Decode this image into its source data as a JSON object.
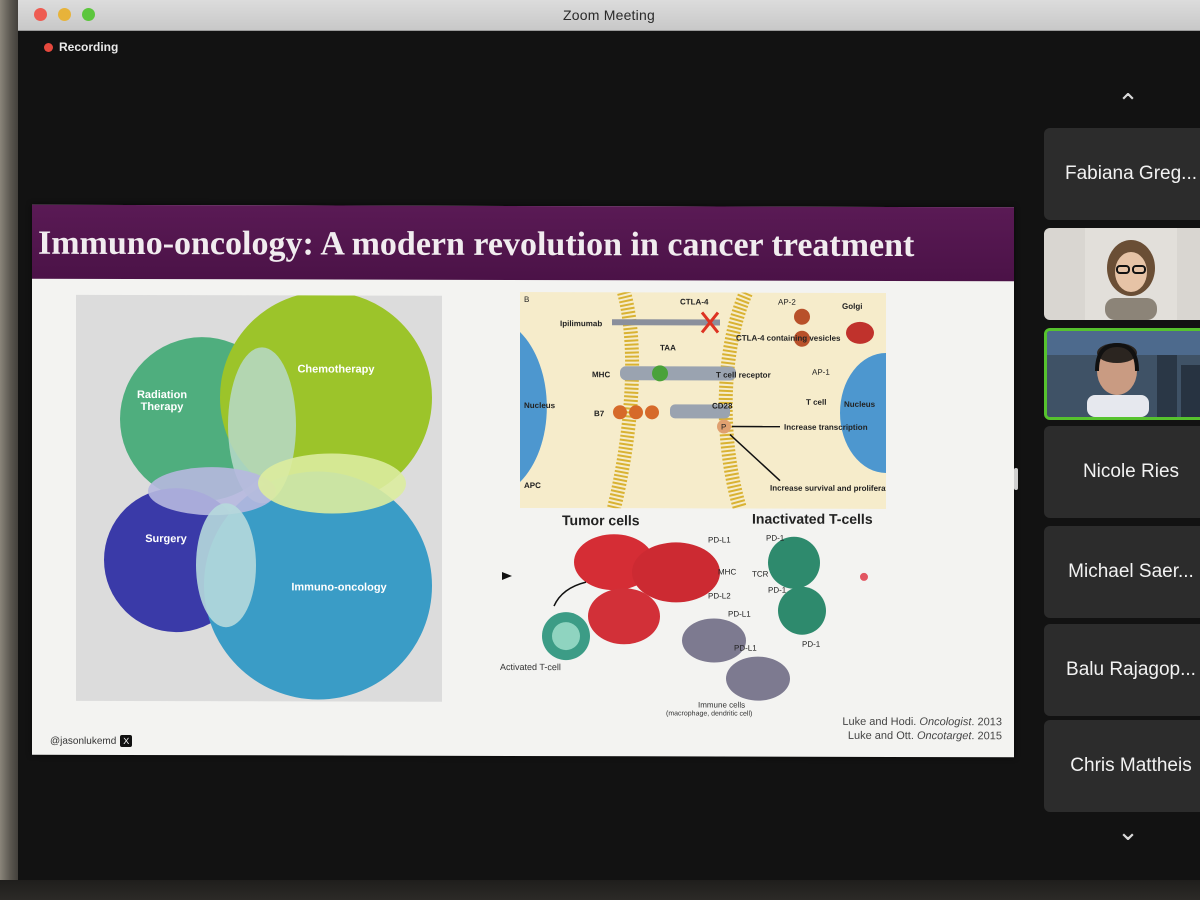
{
  "window": {
    "title": "Zoom Meeting",
    "recording_label": "Recording",
    "colors": {
      "record_dot": "#e5483d",
      "active_speaker": "#56c22e",
      "slide_header": "#4b1247"
    }
  },
  "slide": {
    "title": "Immuno-oncology: A modern revolution in cancer treatment",
    "venn": {
      "radiation": "Radiation\nTherapy",
      "chemotherapy": "Chemotherapy",
      "surgery": "Surgery",
      "immuno": "Immuno-oncology"
    },
    "diagram_top": {
      "panel_letter": "B",
      "labels": {
        "ipilimumab": "Ipilimumab",
        "ctla4": "CTLA-4",
        "taa": "TAA",
        "ctla4_vesicles": "CTLA-4 containing vesicles",
        "ap2": "AP-2",
        "golgi": "Golgi",
        "mhc": "MHC",
        "tcr": "T cell receptor",
        "ap1": "AP-1",
        "nucleus_left": "Nucleus",
        "nucleus_right": "Nucleus",
        "tcell": "T cell",
        "b7": "B7",
        "cd28": "CD28",
        "p": "P",
        "increase_transcription": "Increase transcription",
        "increase_survival": "Increase survival and proliferation",
        "apc": "APC"
      }
    },
    "captions": {
      "tumor": "Tumor cells",
      "inactivated": "Inactivated T-cells"
    },
    "diagram_bottom": {
      "pdl1_a": "PD-L1",
      "pd1_a": "PD-1",
      "mhc": "MHC",
      "tcr": "TCR",
      "pdl2": "PD-L2",
      "pd1_b": "PD-1",
      "pdl1_b": "PD-L1",
      "pdl1_c": "PD-L1",
      "pd1_c": "PD-1",
      "activated": "Activated T-cell",
      "immune_cells": "Immune cells",
      "immune_cells_sub": "(macrophage, dendritic cell)"
    },
    "citations": [
      "Luke and Hodi. ",
      "Oncologist",
      ". 2013",
      "Luke and Ott. ",
      "Oncotarget",
      ". 2015"
    ],
    "handle": "@jasonlukemd",
    "x_icon": "X"
  },
  "participants": [
    {
      "name": "Fabiana Greg...",
      "type": "name"
    },
    {
      "name": "",
      "type": "video"
    },
    {
      "name": "",
      "type": "video-active"
    },
    {
      "name": "Nicole Ries",
      "type": "name"
    },
    {
      "name": "Michael Saer...",
      "type": "name"
    },
    {
      "name": "Balu Rajagop...",
      "type": "name"
    },
    {
      "name": "Chris Mattheis",
      "type": "name"
    }
  ]
}
